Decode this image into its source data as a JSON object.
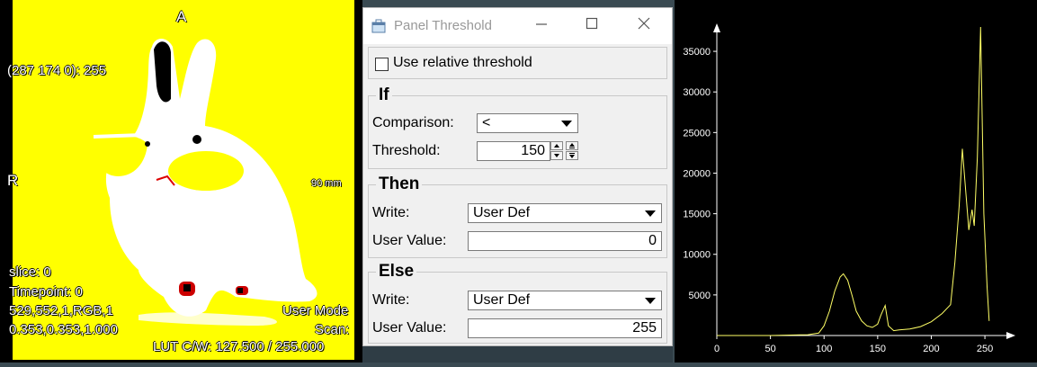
{
  "viewer": {
    "orientation_top": "A",
    "orientation_left": "R",
    "pixel_readout": "(287 174 0): 255",
    "scale_label": "90 mm",
    "slice": "slice:  0",
    "timepoint": "Timepoint: 0",
    "dims": "529,552,1,RGB,1",
    "spacing": "0.353,0.353,1.000",
    "mode": "User Mode",
    "scan": "Scan:",
    "lut": "LUT C/W: 127.500 / 255.000",
    "colors": {
      "background": "#ffff00",
      "foreground": "#ffffff",
      "marks": "#000000",
      "accent": "#ff0000"
    }
  },
  "panel": {
    "title": "Panel Threshold",
    "title_icon": "window-app-icon",
    "minimize_icon": "minimize-icon",
    "maximize_icon": "maximize-icon",
    "close_icon": "close-icon",
    "relative_threshold_label": "Use relative threshold",
    "relative_threshold_checked": false,
    "if_group": {
      "title": "If",
      "comparison_label": "Comparison:",
      "comparison_value": "<",
      "threshold_label": "Threshold:",
      "threshold_value": "150"
    },
    "then_group": {
      "title": "Then",
      "write_label": "Write:",
      "write_value": "User Def",
      "user_value_label": "User Value:",
      "user_value": "0"
    },
    "else_group": {
      "title": "Else",
      "write_label": "Write:",
      "write_value": "User Def",
      "user_value_label": "User Value:",
      "user_value": "255"
    }
  },
  "chart_data": {
    "type": "line",
    "title": "",
    "xlabel": "",
    "ylabel": "",
    "xlim": [
      0,
      260
    ],
    "ylim": [
      0,
      38000
    ],
    "x_ticks": [
      0,
      50,
      100,
      150,
      200,
      250
    ],
    "y_ticks": [
      5000,
      10000,
      15000,
      20000,
      25000,
      30000,
      35000
    ],
    "x_tick_labels": [
      "0",
      "50",
      "100",
      "150",
      "200",
      "250"
    ],
    "y_tick_labels": [
      "5000",
      "10000",
      "15000",
      "20000",
      "25000",
      "30000",
      "35000"
    ],
    "grid": false,
    "line_color": "#ffff66",
    "axis_color": "#ffffff",
    "series": [
      {
        "x": [
          0,
          50,
          85,
          95,
          100,
          105,
          110,
          115,
          118,
          122,
          126,
          130,
          135,
          140,
          145,
          150,
          153,
          157,
          160,
          165,
          170,
          180,
          190,
          200,
          210,
          218,
          222,
          226,
          229,
          232,
          235,
          238,
          240,
          243,
          246,
          249,
          252,
          254
        ],
        "values": [
          0,
          0,
          100,
          300,
          1200,
          3000,
          5500,
          7200,
          7600,
          6800,
          5000,
          3000,
          1800,
          1200,
          1000,
          1400,
          2500,
          3700,
          1200,
          600,
          700,
          800,
          1100,
          1700,
          2700,
          3800,
          9000,
          16000,
          23000,
          18000,
          13000,
          15500,
          13500,
          22000,
          38000,
          15000,
          6000,
          1800
        ]
      }
    ]
  }
}
